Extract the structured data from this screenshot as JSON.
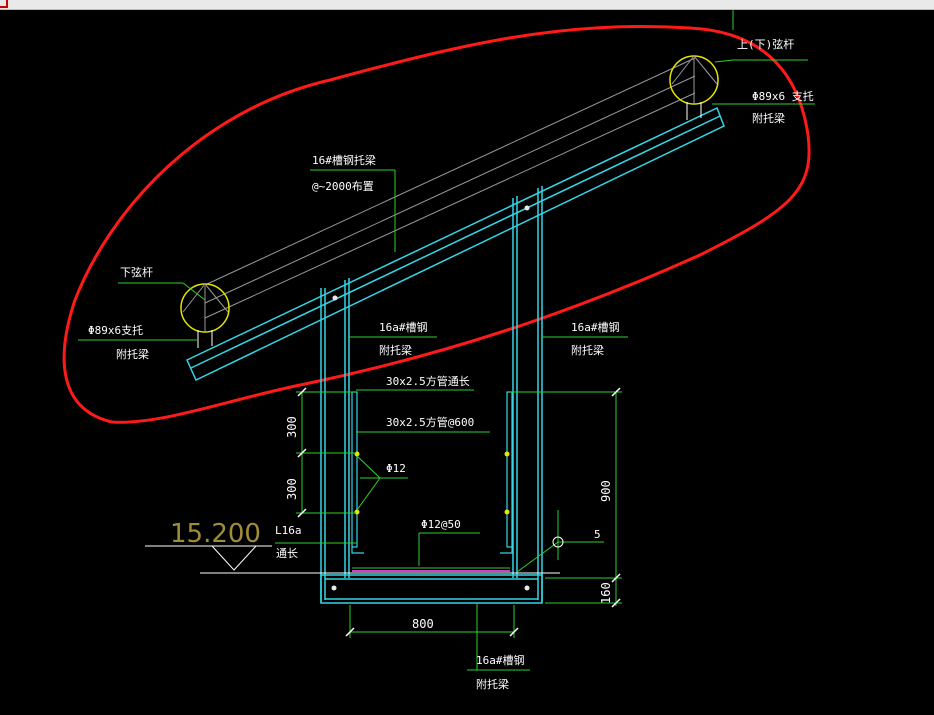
{
  "colors": {
    "background": "#000000",
    "cyan": "#33d6e6",
    "green": "#2cd12c",
    "white": "#ffffff",
    "yellow": "#e6e600",
    "red": "#ff1a1a",
    "magenta": "#d63ad6",
    "elevation": "#a08d37"
  },
  "labels": {
    "upper_chord": "上(下)弦杆",
    "upper_pipe": "Φ89x6 支托",
    "upper_pipe_sub": "附托梁",
    "truss_channel": "16#槽钢托梁",
    "truss_spacing": "@~2000布置",
    "lower_chord": "下弦杆",
    "lower_pipe": "Φ89x6支托",
    "lower_pipe_sub": "附托梁",
    "left_channel": "16a#槽钢",
    "left_channel_sub": "附托梁",
    "right_channel": "16a#槽钢",
    "right_channel_sub": "附托梁",
    "tube_long": "30x2.5方管通长",
    "tube_spaced": "30x2.5方管@600",
    "rebar": "Φ12",
    "rebar_spaced": "Φ12@50",
    "angle": "L16a",
    "angle_sub": "通长",
    "bottom_channel": "16a#槽钢",
    "bottom_channel_sub": "附托梁",
    "weld_size": "5"
  },
  "dimensions": {
    "left_upper": "300",
    "left_lower": "300",
    "right_height": "900",
    "right_base": "160",
    "bottom_width": "800"
  },
  "elevation": "15.200"
}
